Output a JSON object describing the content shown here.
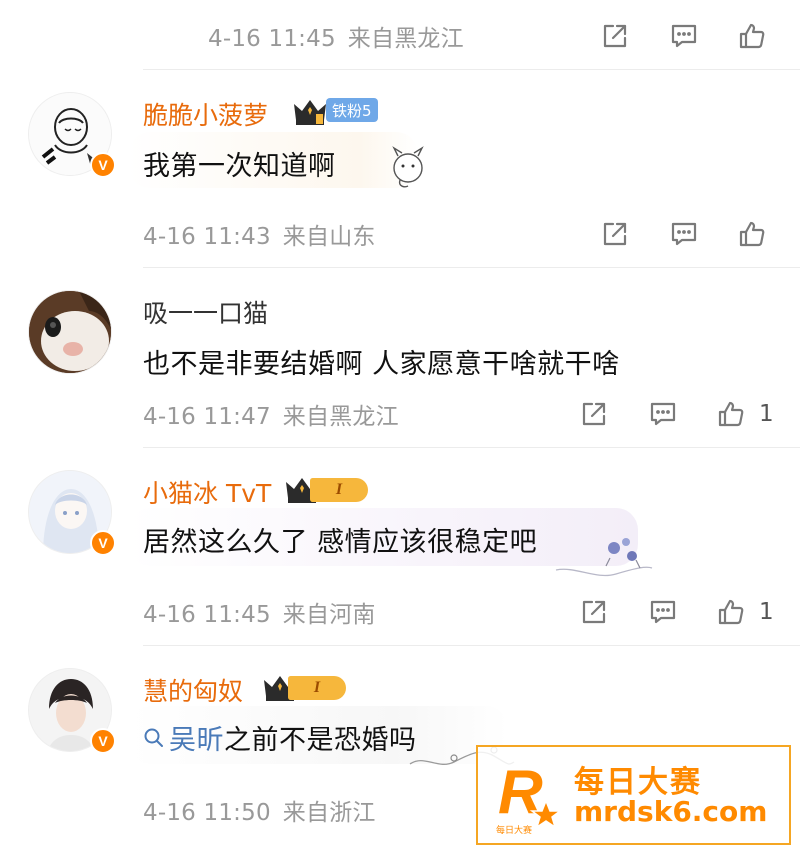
{
  "top_meta": {
    "date": "4-16 11:45",
    "location": "来自黑龙江"
  },
  "comments": [
    {
      "username": "脆脆小菠萝",
      "fan_badge": "铁粉5",
      "text": "我第一次知道啊",
      "date": "4-16 11:43",
      "location": "来自山东",
      "likes": ""
    },
    {
      "username": "吸一一口猫",
      "text": "也不是非要结婚啊 人家愿意干啥就干啥",
      "date": "4-16 11:47",
      "location": "来自黑龙江",
      "likes": "1"
    },
    {
      "username": "小猫冰 TvT",
      "level": "I",
      "text": "居然这么久了 感情应该很稳定吧",
      "date": "4-16 11:45",
      "location": "来自河南",
      "likes": "1"
    },
    {
      "username": "慧的匈奴",
      "level": "I",
      "topic": "吴昕",
      "text": "之前不是恐婚吗",
      "date": "4-16 11:50",
      "location": "来自浙江",
      "likes": ""
    }
  ],
  "icons": {
    "share": "share-icon",
    "comment": "comment-icon",
    "like": "like-icon",
    "search": "search-icon",
    "verified": "verified-icon",
    "crown": "crown-icon"
  },
  "watermark": {
    "cn": "每日大赛",
    "url": "mrdsk6.com",
    "logo_letter": "R",
    "logo_sub": "每日大赛"
  },
  "colors": {
    "vip_name": "#e86b0c",
    "meta": "#999999",
    "accent": "#ff8200",
    "link": "#4a7ab8"
  }
}
